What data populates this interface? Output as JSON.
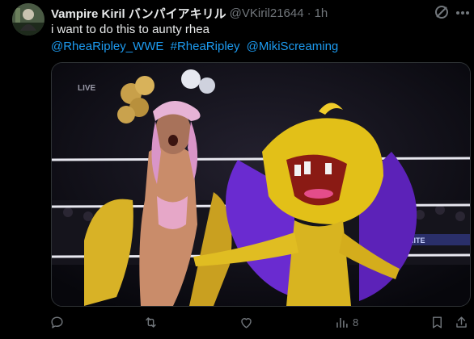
{
  "tweet": {
    "display_name": "Vampire Kiril バンパイアキリル",
    "handle": "@VKiril21644",
    "separator": "·",
    "time": "1h",
    "text": "i want to do this to aunty rhea",
    "links": [
      "@RheaRipley_WWE",
      "#RheaRipley",
      "@MikiScreaming"
    ]
  },
  "media": {
    "live_label": "LIVE",
    "banner_text": "MITE"
  },
  "actions": {
    "reply_icon": "reply-icon",
    "repost_icon": "repost-icon",
    "like_icon": "heart-icon",
    "views_icon": "views-icon",
    "views_count": "8",
    "bookmark_icon": "bookmark-icon",
    "share_icon": "share-icon"
  },
  "colors": {
    "background": "#000000",
    "text": "#e7e9ea",
    "muted": "#71767b",
    "link": "#1d9bf0"
  }
}
